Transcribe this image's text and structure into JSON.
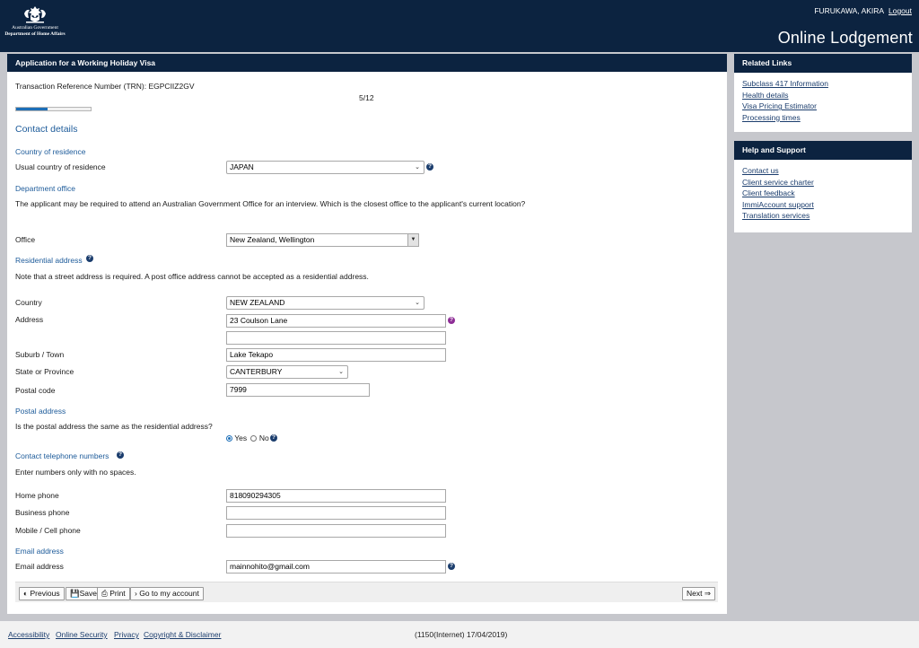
{
  "header": {
    "gov_line1": "Australian Government",
    "gov_line2": "Department of Home Affairs",
    "user_name": "FURUKAWA, AKIRA",
    "logout": "Logout",
    "title": "Online Lodgement"
  },
  "form": {
    "panel_title": "Application for a Working Holiday Visa",
    "trn": "Transaction Reference Number (TRN): EGPCIIZ2GV",
    "page_counter": "5/12",
    "progress": 0.42,
    "heading": "Contact details",
    "country_section": "Country of residence",
    "usual_country_label": "Usual country of residence",
    "usual_country_value": "JAPAN",
    "dept_section": "Department office",
    "dept_question": "The applicant may be required to attend an Australian Government Office for an interview. Which is the closest office to the applicant's current location?",
    "office_label": "Office",
    "office_value": "New Zealand, Wellington",
    "res_section": "Residential address",
    "res_note": "Note that a street address is required. A post office address cannot be accepted as a residential address.",
    "country_label": "Country",
    "country_value": "NEW ZEALAND",
    "address_label": "Address",
    "address_line1": "23 Coulson Lane",
    "address_line2": "",
    "suburb_label": "Suburb / Town",
    "suburb_value": "Lake Tekapo",
    "state_label": "State or Province",
    "state_value": "CANTERBURY",
    "postal_label": "Postal code",
    "postal_value": "7999",
    "postal_section": "Postal address",
    "postal_question": "Is the postal address the same as the residential address?",
    "yes_label": "Yes",
    "no_label": "No",
    "phone_section": "Contact telephone numbers",
    "phone_note": "Enter numbers only with no spaces.",
    "home_label": "Home phone",
    "home_value": "818090294305",
    "business_label": "Business phone",
    "business_value": "",
    "mobile_label": "Mobile / Cell phone",
    "mobile_value": "",
    "email_section": "Email address",
    "email_label": "Email address",
    "email_value": "mainnohito@gmail.com"
  },
  "buttons": {
    "previous": "Previous",
    "save": "Save",
    "print": "Print",
    "account": "Go to my account",
    "next": "Next"
  },
  "related": {
    "title": "Related Links",
    "links": [
      "Subclass 417 Information",
      "Health details",
      "Visa Pricing Estimator",
      "Processing times"
    ]
  },
  "support": {
    "title": "Help and Support",
    "links": [
      "Contact us",
      "Client service charter",
      "Client feedback",
      "ImmiAccount support",
      "Translation services"
    ]
  },
  "footer": {
    "accessibility": "Accessibility",
    "security": "Online Security",
    "privacy": "Privacy",
    "copyright": "Copyright & Disclaimer",
    "version": "(1150(Internet) 17/04/2019)"
  }
}
